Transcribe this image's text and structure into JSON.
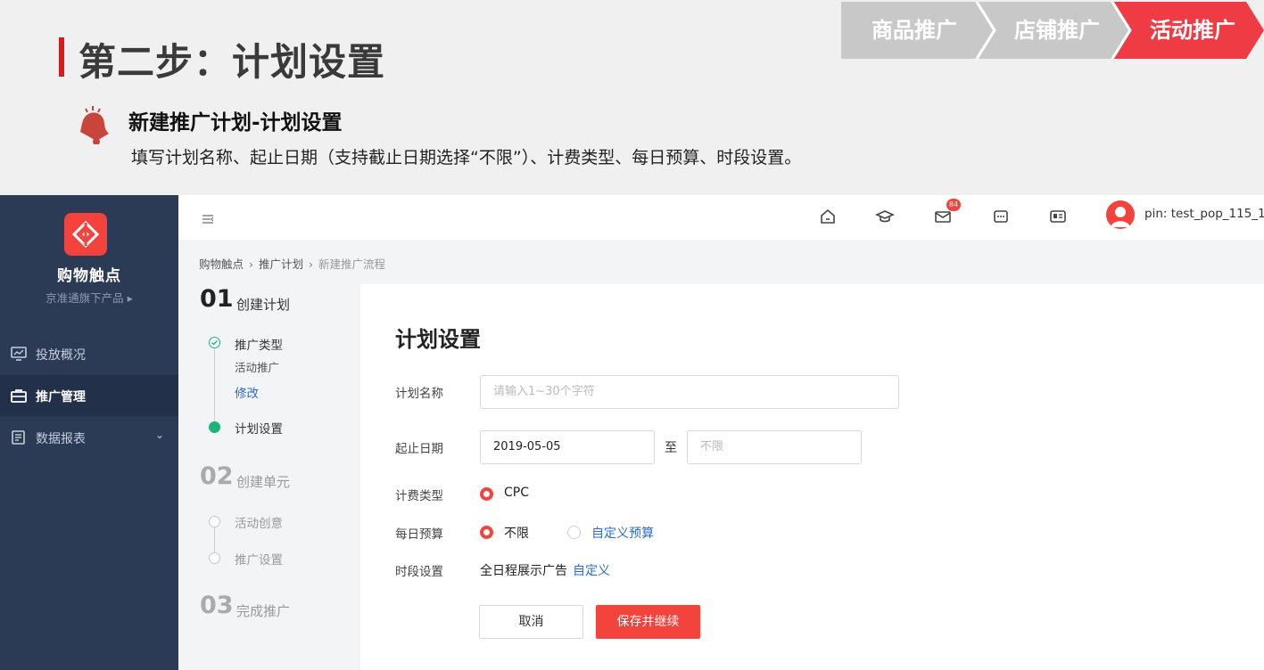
{
  "slide": {
    "title": "第二步：计划设置",
    "chevrons": [
      "商品推广",
      "店铺推广",
      "活动推广"
    ],
    "subtitle": "新建推广计划-计划设置",
    "description": "填写计划名称、起止日期（支持截止日期选择“不限”）、计费类型、每日预算、时段设置。",
    "colors": {
      "accent": "#d71920",
      "chevron_inactive": "#c8c8c8",
      "chevron_active": "#ef3b44"
    }
  },
  "sidebar": {
    "brand": "购物触点",
    "brand_sub": "京准通旗下产品 ▸",
    "items": [
      {
        "label": "投放概况",
        "icon": "monitor-icon"
      },
      {
        "label": "推广管理",
        "icon": "briefcase-icon",
        "active": true
      },
      {
        "label": "数据报表",
        "icon": "report-icon",
        "caret": "⌄"
      }
    ],
    "colors": {
      "bg": "#2b3a55",
      "active_bg": "#233049",
      "logo": "#f4433d"
    }
  },
  "topbar": {
    "icons": [
      "home-icon",
      "graduation-cap-icon",
      "mail-icon",
      "chat-icon",
      "id-card-icon"
    ],
    "mail_badge": "84",
    "user": "pin: test_pop_115_1"
  },
  "breadcrumb": [
    "购物触点",
    "推广计划",
    "新建推广流程"
  ],
  "steps": {
    "step1": {
      "num": "01",
      "label": "创建计划"
    },
    "step1_sub": {
      "type_label": "推广类型",
      "type_value": "活动推广",
      "edit": "修改",
      "plan_setting": "计划设置"
    },
    "step2": {
      "num": "02",
      "label": "创建单元"
    },
    "step2_sub": [
      "活动创意",
      "推广设置"
    ],
    "step3": {
      "num": "03",
      "label": "完成推广"
    },
    "colors": {
      "done": "#1bb57a"
    }
  },
  "form": {
    "title": "计划设置",
    "name_label": "计划名称",
    "name_placeholder": "请输入1~30个字符",
    "date_label": "起止日期",
    "start_date": "2019-05-05",
    "to": "至",
    "end_placeholder": "不限",
    "billing_label": "计费类型",
    "billing_value": "CPC",
    "budget_label": "每日预算",
    "budget_unlimited": "不限",
    "budget_custom": "自定义预算",
    "time_label": "时段设置",
    "time_value": "全日程展示广告",
    "time_custom": "自定义",
    "cancel": "取消",
    "save": "保存并继续",
    "colors": {
      "primary": "#f4433d",
      "link": "#2d6bd6"
    }
  }
}
